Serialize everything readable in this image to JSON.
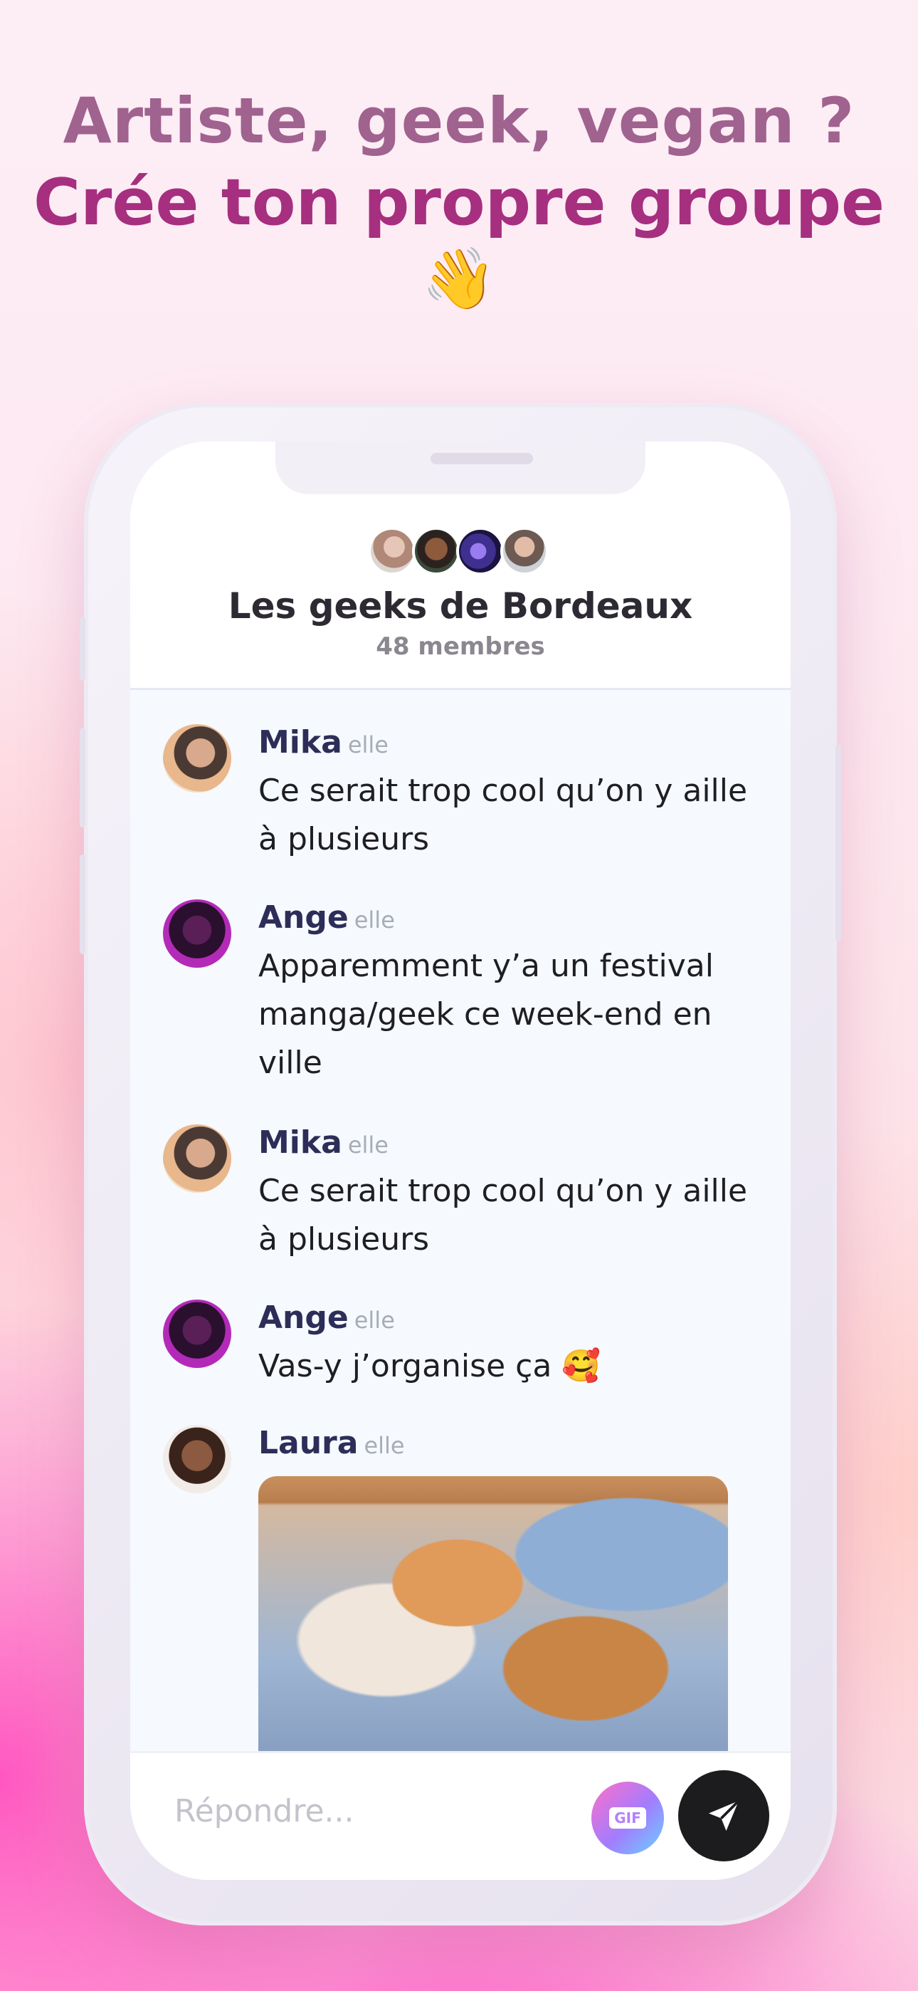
{
  "headline": {
    "line1": "Artiste, geek, vegan ?",
    "line2": "Crée ton propre groupe",
    "emoji": "👋"
  },
  "group": {
    "name": "Les geeks de Bordeaux",
    "members": "48 membres"
  },
  "messages": [
    {
      "name": "Mika",
      "pronoun": "elle",
      "text": "Ce serait trop cool qu’on y aille à plusieurs"
    },
    {
      "name": "Ange",
      "pronoun": "elle",
      "text": "Apparemment y’a un festival manga/geek ce week-end en ville"
    },
    {
      "name": "Mika",
      "pronoun": "elle",
      "text": "Ce serait trop cool qu’on y aille à plusieurs"
    },
    {
      "name": "Ange",
      "pronoun": "elle",
      "text": "Vas-y j’organise ça 🥰"
    },
    {
      "name": "Laura",
      "pronoun": "elle",
      "image": "cat-and-dog-photo"
    }
  ],
  "composer": {
    "placeholder": "Répondre...",
    "gif_label": "GIF",
    "send_icon": "send-arrow-icon"
  }
}
